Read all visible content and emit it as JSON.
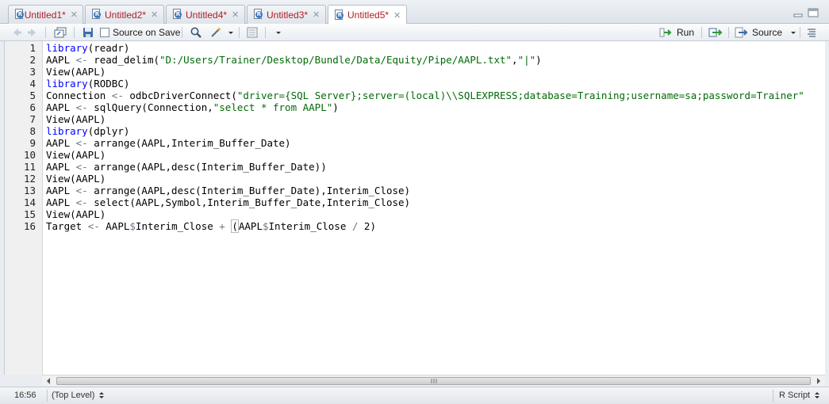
{
  "tabs": [
    {
      "label": "Untitled1*",
      "active": false
    },
    {
      "label": "Untitled2*",
      "active": false
    },
    {
      "label": "Untitled4*",
      "active": false
    },
    {
      "label": "Untitled3*",
      "active": false
    },
    {
      "label": "Untitled5*",
      "active": true
    }
  ],
  "toolbar": {
    "source_on_save_label": "Source on Save",
    "source_on_save_checked": false,
    "run_label": "Run",
    "source_label": "Source"
  },
  "editor": {
    "line_numbers": [
      "1",
      "2",
      "3",
      "4",
      "5",
      "6",
      "7",
      "8",
      "9",
      "10",
      "11",
      "12",
      "13",
      "14",
      "15",
      "16"
    ],
    "lines": [
      [
        {
          "t": "kw",
          "v": "library"
        },
        {
          "t": "p",
          "v": "(readr)"
        }
      ],
      [
        {
          "t": "p",
          "v": "AAPL "
        },
        {
          "t": "op",
          "v": "<-"
        },
        {
          "t": "p",
          "v": " read_delim("
        },
        {
          "t": "st",
          "v": "\"D:/Users/Trainer/Desktop/Bundle/Data/Equity/Pipe/AAPL.txt\""
        },
        {
          "t": "p",
          "v": ","
        },
        {
          "t": "st",
          "v": "\"|\""
        },
        {
          "t": "p",
          "v": ")"
        }
      ],
      [
        {
          "t": "p",
          "v": "View(AAPL)"
        }
      ],
      [
        {
          "t": "kw",
          "v": "library"
        },
        {
          "t": "p",
          "v": "(RODBC)"
        }
      ],
      [
        {
          "t": "p",
          "v": "Connection "
        },
        {
          "t": "op",
          "v": "<-"
        },
        {
          "t": "p",
          "v": " odbcDriverConnect("
        },
        {
          "t": "st",
          "v": "\"driver={SQL Server};server=(local)\\\\SQLEXPRESS;database=Training;username=sa;password=Trainer\""
        }
      ],
      [
        {
          "t": "p",
          "v": "AAPL "
        },
        {
          "t": "op",
          "v": "<-"
        },
        {
          "t": "p",
          "v": " sqlQuery(Connection,"
        },
        {
          "t": "st",
          "v": "\"select * from AAPL\""
        },
        {
          "t": "p",
          "v": ")"
        }
      ],
      [
        {
          "t": "p",
          "v": "View(AAPL)"
        }
      ],
      [
        {
          "t": "kw",
          "v": "library"
        },
        {
          "t": "p",
          "v": "(dplyr)"
        }
      ],
      [
        {
          "t": "p",
          "v": "AAPL "
        },
        {
          "t": "op",
          "v": "<-"
        },
        {
          "t": "p",
          "v": " arrange(AAPL,Interim_Buffer_Date)"
        }
      ],
      [
        {
          "t": "p",
          "v": "View(AAPL)"
        }
      ],
      [
        {
          "t": "p",
          "v": "AAPL "
        },
        {
          "t": "op",
          "v": "<-"
        },
        {
          "t": "p",
          "v": " arrange(AAPL,desc(Interim_Buffer_Date))"
        }
      ],
      [
        {
          "t": "p",
          "v": "View(AAPL)"
        }
      ],
      [
        {
          "t": "p",
          "v": "AAPL "
        },
        {
          "t": "op",
          "v": "<-"
        },
        {
          "t": "p",
          "v": " arrange(AAPL,desc(Interim_Buffer_Date),Interim_Close)"
        }
      ],
      [
        {
          "t": "p",
          "v": "AAPL "
        },
        {
          "t": "op",
          "v": "<-"
        },
        {
          "t": "p",
          "v": " select(AAPL,Symbol,Interim_Buffer_Date,Interim_Close)"
        }
      ],
      [
        {
          "t": "p",
          "v": "View(AAPL)"
        }
      ],
      [
        {
          "t": "p",
          "v": "Target "
        },
        {
          "t": "op",
          "v": "<-"
        },
        {
          "t": "p",
          "v": " AAPL"
        },
        {
          "t": "op",
          "v": "$"
        },
        {
          "t": "p",
          "v": "Interim_Close "
        },
        {
          "t": "op",
          "v": "+"
        },
        {
          "t": "p",
          "v": " "
        },
        {
          "t": "br",
          "v": "("
        },
        {
          "t": "p",
          "v": "AAPL"
        },
        {
          "t": "op",
          "v": "$"
        },
        {
          "t": "p",
          "v": "Interim_Close "
        },
        {
          "t": "op",
          "v": "/"
        },
        {
          "t": "p",
          "v": " 2)"
        }
      ]
    ]
  },
  "status": {
    "cursor": "16:56",
    "scope": "(Top Level)",
    "file_type": "R Script"
  },
  "colors": {
    "keyword": "#0000ff",
    "string": "#036a07",
    "operator": "#687687",
    "tab_label": "#b01c24"
  }
}
